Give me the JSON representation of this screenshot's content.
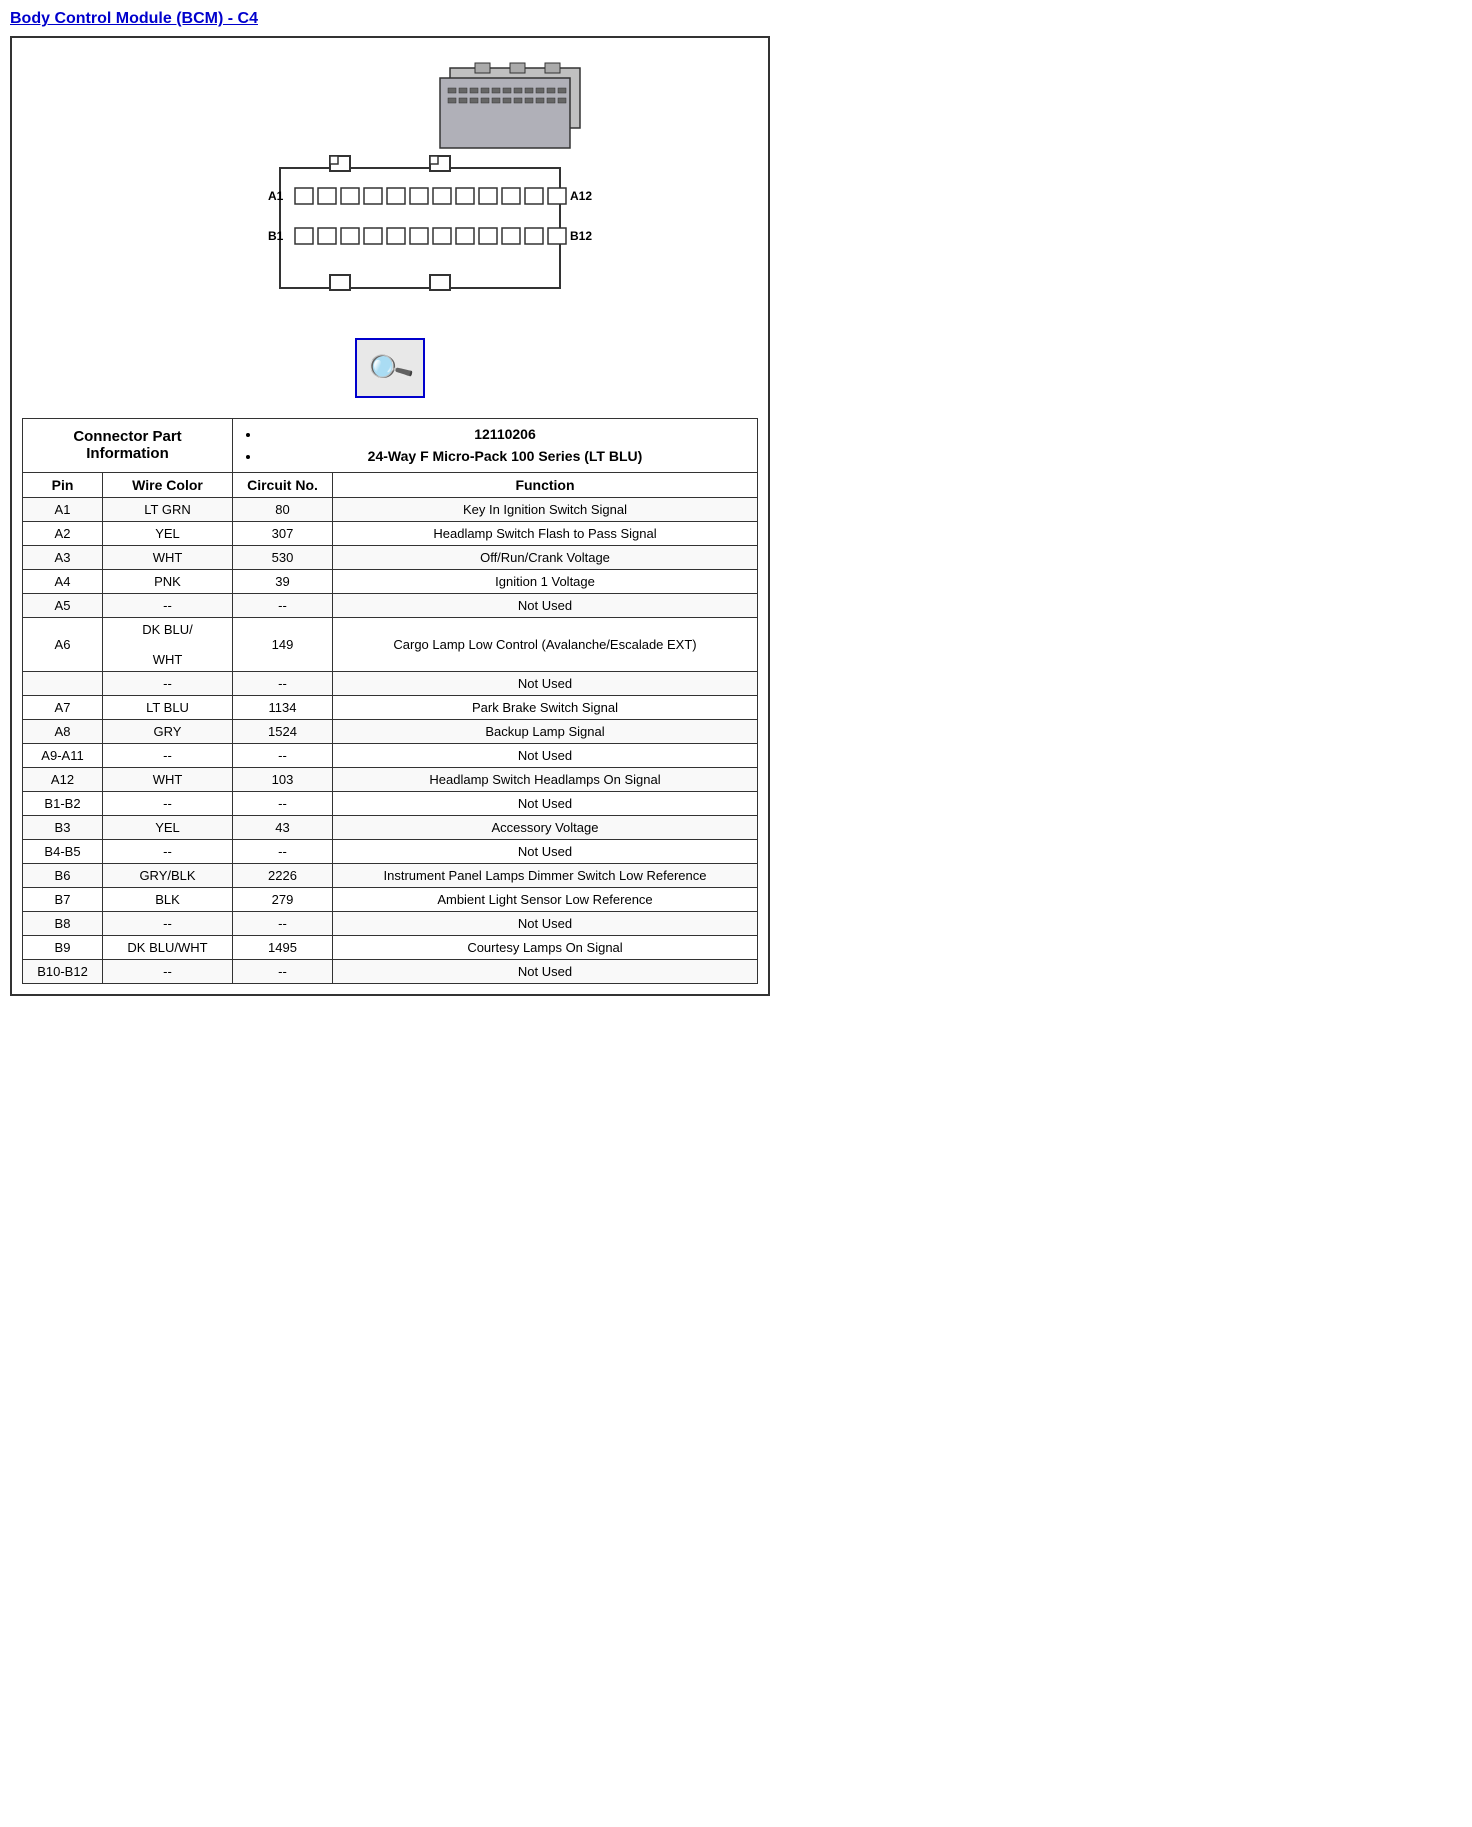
{
  "title": "Body Control Module (BCM) - C4",
  "connector_info": {
    "label": "Connector Part Information",
    "items": [
      "12110206",
      "24-Way F Micro-Pack 100 Series (LT BLU)"
    ]
  },
  "table_headers": {
    "pin": "Pin",
    "wire_color": "Wire Color",
    "circuit_no": "Circuit No.",
    "function": "Function"
  },
  "rows": [
    {
      "pin": "A1",
      "wire_color": "LT GRN",
      "circuit_no": "80",
      "function": "Key In Ignition Switch Signal"
    },
    {
      "pin": "A2",
      "wire_color": "YEL",
      "circuit_no": "307",
      "function": "Headlamp Switch Flash to Pass Signal"
    },
    {
      "pin": "A3",
      "wire_color": "WHT",
      "circuit_no": "530",
      "function": "Off/Run/Crank Voltage"
    },
    {
      "pin": "A4",
      "wire_color": "PNK",
      "circuit_no": "39",
      "function": "Ignition 1 Voltage"
    },
    {
      "pin": "A5",
      "wire_color": "--",
      "circuit_no": "--",
      "function": "Not Used"
    },
    {
      "pin": "A6",
      "wire_color": "DK BLU/\n\nWHT",
      "circuit_no": "149",
      "function": "Cargo Lamp Low Control (Avalanche/Escalade EXT)"
    },
    {
      "pin": "",
      "wire_color": "--",
      "circuit_no": "--",
      "function": "Not Used"
    },
    {
      "pin": "A7",
      "wire_color": "LT BLU",
      "circuit_no": "1134",
      "function": "Park Brake Switch Signal"
    },
    {
      "pin": "A8",
      "wire_color": "GRY",
      "circuit_no": "1524",
      "function": "Backup Lamp Signal"
    },
    {
      "pin": "A9-A11",
      "wire_color": "--",
      "circuit_no": "--",
      "function": "Not Used"
    },
    {
      "pin": "A12",
      "wire_color": "WHT",
      "circuit_no": "103",
      "function": "Headlamp Switch Headlamps On Signal"
    },
    {
      "pin": "B1-B2",
      "wire_color": "--",
      "circuit_no": "--",
      "function": "Not Used"
    },
    {
      "pin": "B3",
      "wire_color": "YEL",
      "circuit_no": "43",
      "function": "Accessory Voltage"
    },
    {
      "pin": "B4-B5",
      "wire_color": "--",
      "circuit_no": "--",
      "function": "Not Used"
    },
    {
      "pin": "B6",
      "wire_color": "GRY/BLK",
      "circuit_no": "2226",
      "function": "Instrument Panel Lamps Dimmer Switch Low Reference"
    },
    {
      "pin": "B7",
      "wire_color": "BLK",
      "circuit_no": "279",
      "function": "Ambient Light Sensor Low Reference"
    },
    {
      "pin": "B8",
      "wire_color": "--",
      "circuit_no": "--",
      "function": "Not Used"
    },
    {
      "pin": "B9",
      "wire_color": "DK BLU/WHT",
      "circuit_no": "1495",
      "function": "Courtesy Lamps On Signal"
    },
    {
      "pin": "B10-B12",
      "wire_color": "--",
      "circuit_no": "--",
      "function": "Not Used"
    }
  ]
}
